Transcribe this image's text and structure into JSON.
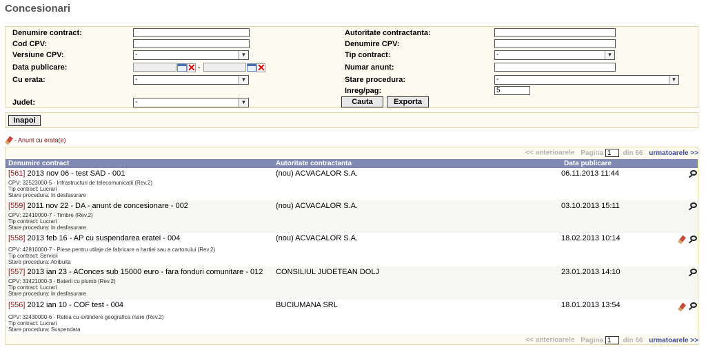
{
  "page": {
    "title": "Concesionari"
  },
  "filters": {
    "denumire_contract": {
      "label": "Denumire contract:",
      "value": ""
    },
    "cod_cpv": {
      "label": "Cod CPV:",
      "value": ""
    },
    "versiune_cpv": {
      "label": "Versiune CPV:",
      "value": "-"
    },
    "data_publicare": {
      "label": "Data publicare:",
      "separator": "-"
    },
    "cu_erata": {
      "label": "Cu erata:",
      "value": "-"
    },
    "judet": {
      "label": "Judet:",
      "value": "-"
    },
    "autoritate": {
      "label": "Autoritate contractanta:",
      "value": ""
    },
    "denumire_cpv": {
      "label": "Denumire CPV:",
      "value": ""
    },
    "tip_contract": {
      "label": "Tip contract:",
      "value": "-"
    },
    "numar_anunt": {
      "label": "Numar anunt:",
      "value": ""
    },
    "stare_procedura": {
      "label": "Stare procedura:",
      "value": "-"
    },
    "inreg_pag": {
      "label": "Inreg/pag:",
      "value": "5"
    },
    "search_label": "Cauta",
    "export_label": "Exporta"
  },
  "back_label": "Inapoi",
  "legend_text": "- Anunt cu erata(e)",
  "pager": {
    "prev": "<< anterioarele",
    "page_label": "Pagina",
    "page": "1",
    "of": "din 66",
    "next": "urmatoarele >>"
  },
  "table": {
    "headers": [
      "Denumire contract",
      "Autoritate contractanta",
      "Data publicare"
    ],
    "rows": [
      {
        "id": "[561]",
        "title": "2013 nov 06 - test SAD - 001",
        "authority": "(nou) ACVACALOR S.A.",
        "date": "06.11.2013 11:44",
        "cpv": "CPV: 32523000-5 - Infrastructuri de telecomunicatii (Rev.2)",
        "tip": "Tip contract: Lucrari",
        "stare": "Stare procedura: In desfasurare",
        "erata": false
      },
      {
        "id": "[559]",
        "title": "2011 nov 22 - DA - anunt de concesionare - 002",
        "authority": "(nou) ACVACALOR S.A.",
        "date": "03.10.2013 15:11",
        "cpv": "CPV: 22410000-7 - Timbre (Rev.2)",
        "tip": "Tip contract: Lucrari",
        "stare": "Stare procedura: In desfasurare",
        "erata": false
      },
      {
        "id": "[558]",
        "title": "2013 feb 16 - AP cu suspendarea eratei - 004",
        "authority": "(nou) ACVACALOR S.A.",
        "date": "18.02.2013 10:14",
        "cpv": "CPV: 42810000-7 - Piese pentru utilaje de fabricare a hartiei sau a cartonului (Rev.2)",
        "tip": "Tip contract: Servicii",
        "stare": "Stare procedura: Atribuita",
        "erata": true
      },
      {
        "id": "[557]",
        "title": "2013 ian 23 - AConces sub 15000 euro - fara fonduri comunitare - 012",
        "authority": "CONSILIUL JUDETEAN DOLJ",
        "date": "23.01.2013 14:10",
        "cpv": "CPV: 31421000-3 - Baterii cu plumb (Rev.2)",
        "tip": "Tip contract: Lucrari",
        "stare": "Stare procedura: In desfasurare",
        "erata": false
      },
      {
        "id": "[556]",
        "title": "2012 ian 10 - COF test - 004",
        "authority": "BUCIUMANA SRL",
        "date": "18.01.2013 13:54",
        "cpv": "CPV: 32430000-6 - Retea cu extindere geografica mare (Rev.2)",
        "tip": "Tip contract: Lucrari",
        "stare": "Stare procedura: Suspendata",
        "erata": true
      }
    ]
  },
  "icons": {
    "detail": "magnifier-icon",
    "erata": "pencil-icon",
    "calendar": "calendar-icon",
    "clear": "clear-date-icon"
  }
}
